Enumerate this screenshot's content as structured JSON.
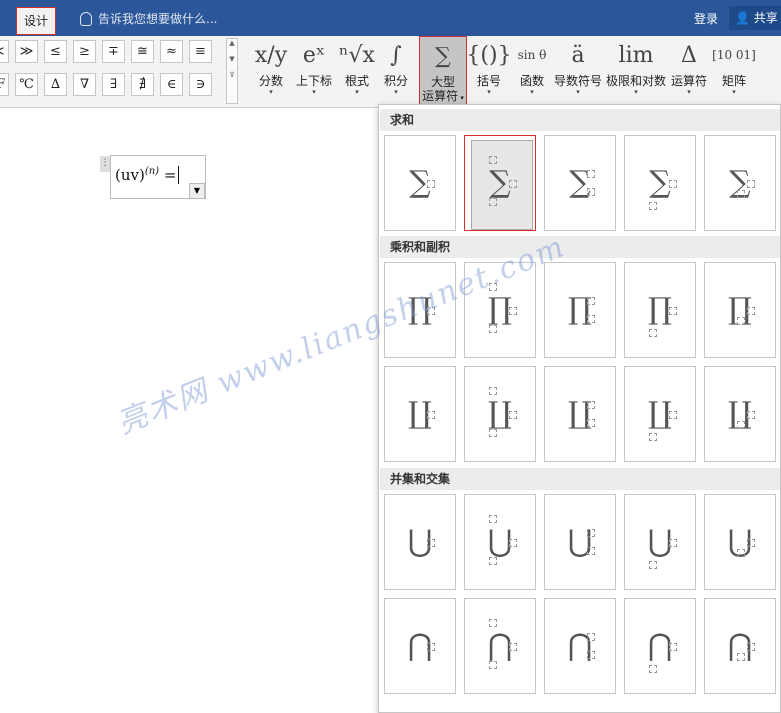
{
  "titlebar": {
    "active_tab": "设计",
    "tell_me": "告诉我您想要做什么...",
    "login": "登录",
    "share": "共享"
  },
  "ribbon": {
    "symbols": [
      "≪",
      "≫",
      "≤",
      "≥",
      "∓",
      "≅",
      "≈",
      "≡",
      "°F",
      "℃",
      "∆",
      "∇",
      "∃",
      "∄",
      "∈",
      "∋"
    ],
    "structures": [
      {
        "label": "分数",
        "icon": "x/y"
      },
      {
        "label": "上下标",
        "icon": "eˣ"
      },
      {
        "label": "根式",
        "icon": "ⁿ√x"
      },
      {
        "label": "积分",
        "icon": "∫"
      },
      {
        "label": "大型\n运算符",
        "icon": "∑"
      },
      {
        "label": "括号",
        "icon": "{()}"
      },
      {
        "label": "函数",
        "icon": "sin θ"
      },
      {
        "label": "导数符号",
        "icon": "ä"
      },
      {
        "label": "极限和对数",
        "icon": "lim"
      },
      {
        "label": "运算符",
        "icon": "Δ"
      },
      {
        "label": "矩阵",
        "icon": "[10 01]"
      }
    ],
    "large_operator_line1": "大型",
    "large_operator_line2": "运算符"
  },
  "equation": {
    "text": "(uv)⁽ⁿ⁾ =|"
  },
  "panel": {
    "sections": [
      {
        "title": "求和",
        "symbol": "∑"
      },
      {
        "title": "乘积和副积",
        "symbol": "∏",
        "symbol2": "∐"
      },
      {
        "title": "并集和交集",
        "symbol": "⋃",
        "symbol2": "⋂"
      }
    ]
  },
  "watermark": "亮术网 www.liangshunet.com"
}
